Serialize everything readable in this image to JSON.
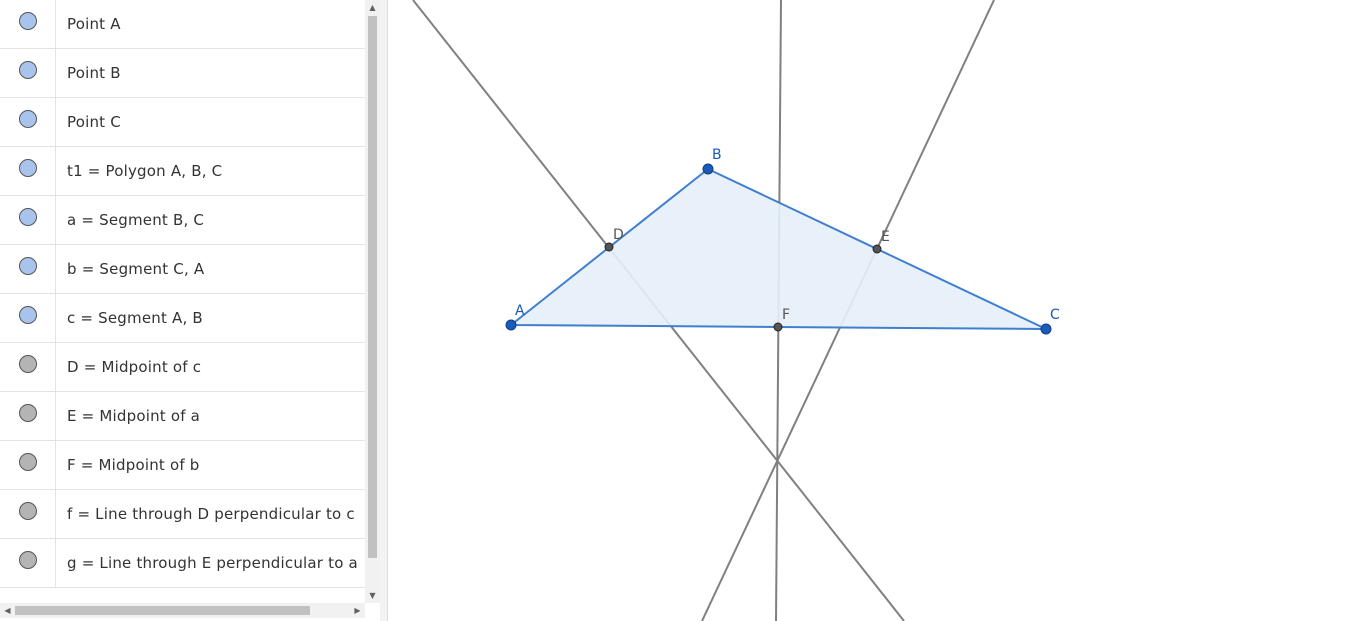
{
  "algebra_view": {
    "items": [
      {
        "label": "Point A",
        "visible": true
      },
      {
        "label": "Point B",
        "visible": true
      },
      {
        "label": "Point C",
        "visible": true
      },
      {
        "label": "t1 = Polygon A, B, C",
        "visible": true
      },
      {
        "label": "a = Segment B, C",
        "visible": true
      },
      {
        "label": "b = Segment C, A",
        "visible": true
      },
      {
        "label": "c = Segment A, B",
        "visible": true
      },
      {
        "label": "D = Midpoint of c",
        "visible": false
      },
      {
        "label": "E = Midpoint of a",
        "visible": false
      },
      {
        "label": "F = Midpoint of b",
        "visible": false
      },
      {
        "label": "f = Line through D perpendicular to c",
        "visible": false
      },
      {
        "label": "g = Line through E perpendicular to a",
        "visible": false
      }
    ]
  },
  "graphics_view": {
    "point_labels": {
      "A": "A",
      "B": "B",
      "C": "C",
      "D": "D",
      "E": "E",
      "F": "F"
    }
  },
  "colors": {
    "visible_marble": "#a8c4ec",
    "hidden_marble": "#b4b4b4",
    "polygon_stroke": "#3f7fcf",
    "polygon_fill": "#e6eff9",
    "free_point": "#1a5bb8",
    "dependent_point": "#555555",
    "line": "#808080",
    "point_label_blue": "#1a5bb8",
    "point_label_gray": "#555555"
  }
}
